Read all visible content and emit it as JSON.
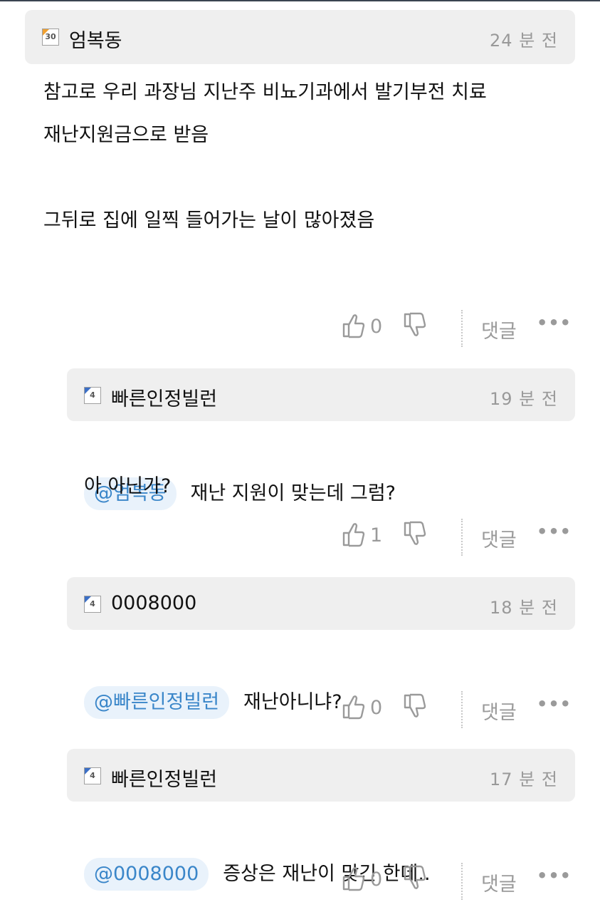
{
  "comments": [
    {
      "author": "엄복동",
      "level": "30",
      "time": "24 분 전",
      "mention": "",
      "body": "참고로 우리 과장님 지난주 비뇨기과에서 발기부전 치료\n재난지원금으로 받음\n\n그뒤로 집에 일찍 들어가는 날이 많아졌음",
      "likes": "0",
      "reply_label": "댓글",
      "more": "•••"
    },
    {
      "author": "빠른인정빌런",
      "level": "4",
      "time": "19 분 전",
      "mention": "@엄복동",
      "body": "재난 지원이 맞는데 그럼?",
      "body2": "아 아닌가?",
      "likes": "1",
      "reply_label": "댓글",
      "more": "•••"
    },
    {
      "author": "0008000",
      "level": "4",
      "time": "18 분 전",
      "mention": "@빠른인정빌런",
      "body": "재난아니냐?",
      "likes": "0",
      "reply_label": "댓글",
      "more": "•••"
    },
    {
      "author": "빠른인정빌런",
      "level": "4",
      "time": "17 분 전",
      "mention": "@0008000",
      "body": "증상은 재난이 맞긴 한데..",
      "likes": "0",
      "reply_label": "댓글",
      "more": "•••"
    }
  ],
  "colors": {
    "header_bg": "#efefef",
    "mention_bg": "#e9f2fb",
    "mention_text": "#3a86c9",
    "muted": "#999999",
    "level30_badge": "#f0a030",
    "level4_badge": "#3b6fc6"
  },
  "icons": [
    "thumbs-up-icon",
    "thumbs-down-icon",
    "more-icon"
  ]
}
